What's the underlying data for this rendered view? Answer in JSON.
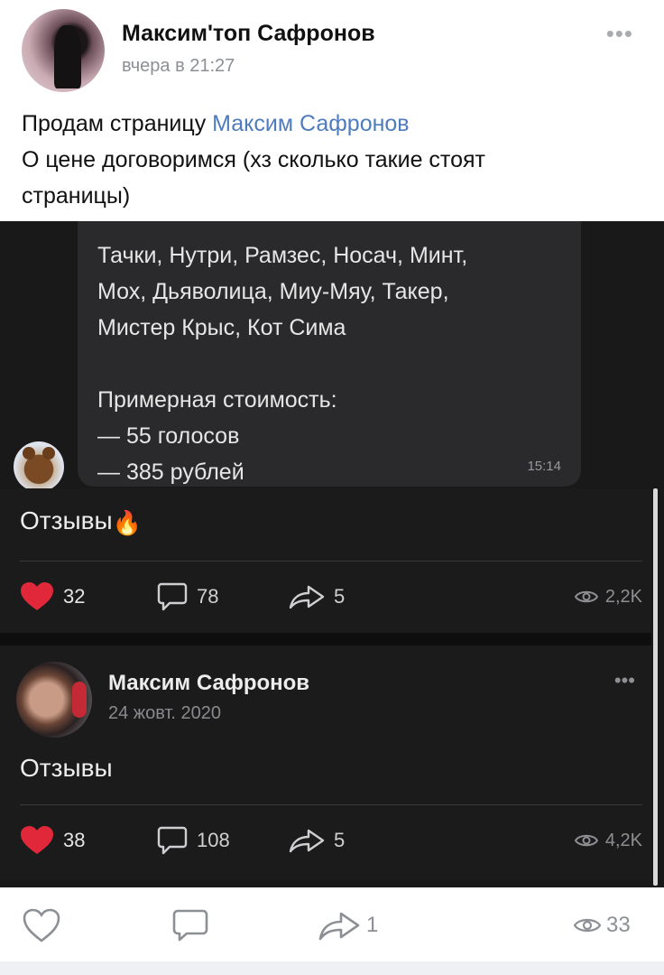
{
  "post": {
    "author": "Максим'топ Сафронов",
    "time": "вчера в 21:27",
    "more": "•••",
    "text_line1_prefix": "Продам страницу ",
    "text_line1_link": "Максим Сафронов",
    "text_line2": "О цене договоримся (хз сколько такие стоят",
    "text_line3": "страницы)"
  },
  "screenshot": {
    "message": {
      "line1": "Тачки, Нутри, Рамзес, Носач, Минт,",
      "line2": "Мох, Дьяволица, Миу-Мяу, Такер,",
      "line3": "Мистер Крыс, Кот Сима",
      "line4": "Примерная стоимость:",
      "line5": "— 55 голосов",
      "line6": "— 385 рублей",
      "time": "15:14"
    },
    "card1": {
      "title": "Отзывы",
      "emoji": "🔥",
      "likes": "32",
      "comments": "78",
      "shares": "5",
      "views": "2,2K"
    },
    "card2": {
      "author": "Максим Сафронов",
      "date": "24 жовт. 2020",
      "more": "•••",
      "title": "Отзывы",
      "likes": "38",
      "comments": "108",
      "shares": "5",
      "views": "4,2K"
    }
  },
  "footer": {
    "likes": "",
    "comments": "",
    "shares": "1",
    "views": "33"
  },
  "colors": {
    "like_red": "#e0283a",
    "link_blue": "#4f7cbc",
    "dark_bg": "#19191a"
  }
}
